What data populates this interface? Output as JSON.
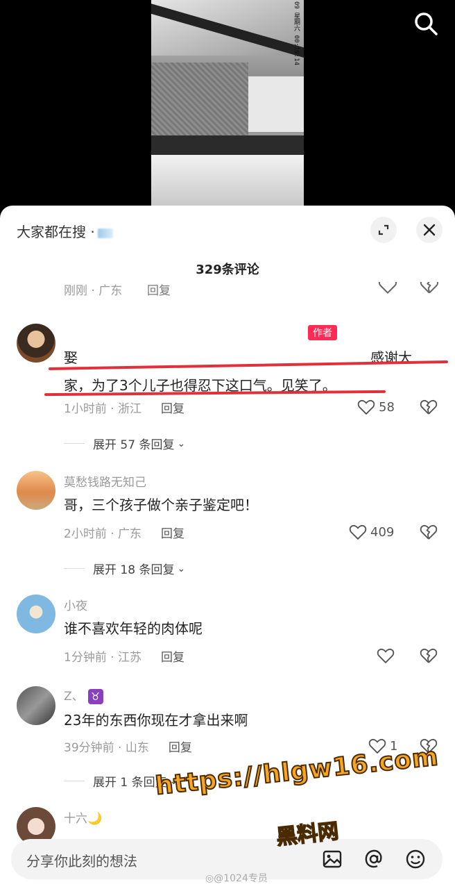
{
  "video": {
    "timestamp_text": "09 星期六 00:19:14"
  },
  "top_bar": {
    "search_icon": "search-icon"
  },
  "sheet": {
    "hot_search_label": "大家都在搜 ·",
    "comment_count": "329条评论",
    "cut_row": {
      "time": "刚刚 · 广东",
      "reply": "回复"
    },
    "comments": [
      {
        "username": "",
        "badge": "作者",
        "text_line1_start": "娶",
        "text_line1_end": "感谢大",
        "text_line2": "家，为了3个儿子也得忍下这口气。见笑了。",
        "time_location": "1小时前 · 浙江",
        "reply": "回复",
        "likes": "58",
        "expand": "展开 57 条回复"
      },
      {
        "username": "莫愁钱路无知己",
        "text": "哥，三个孩子做个亲子鉴定吧！",
        "time_location": "2小时前 · 广东",
        "reply": "回复",
        "likes": "409",
        "expand": "展开 18 条回复"
      },
      {
        "username": "小夜",
        "text": "谁不喜欢年轻的肉体呢",
        "time_location": "1分钟前 · 江苏",
        "reply": "回复",
        "likes": ""
      },
      {
        "username": "Z、",
        "emoji": "♉",
        "text": "23年的东西你现在才拿出来啊",
        "time_location": "39分钟前 · 山东",
        "reply": "回复",
        "likes": "1",
        "expand": "展开 1 条回复"
      },
      {
        "username": "十六🌙"
      }
    ]
  },
  "input": {
    "placeholder": "分享你此刻的想法"
  },
  "watermark": {
    "url": "https://hlgw16.com",
    "name": "黑料网",
    "weibo": "@1024专员"
  },
  "colors": {
    "accent_red": "#fe2c55",
    "underline_red": "#e0313b",
    "watermark_orange": "#f6a623"
  }
}
